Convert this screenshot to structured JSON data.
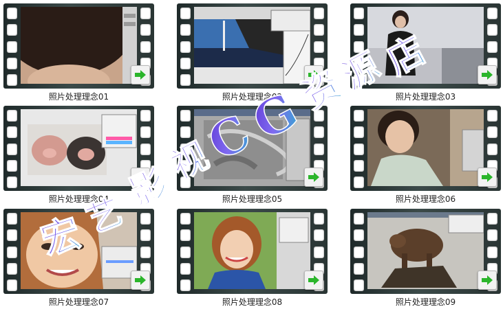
{
  "tiles": [
    {
      "caption": "照片处理理念01"
    },
    {
      "caption": "照片处理理念02"
    },
    {
      "caption": "照片处理理念03"
    },
    {
      "caption": "照片处理理念04"
    },
    {
      "caption": "照片处理理念05"
    },
    {
      "caption": "照片处理理念06"
    },
    {
      "caption": "照片处理理念07"
    },
    {
      "caption": "照片处理理念08"
    },
    {
      "caption": "照片处理理念09"
    }
  ],
  "watermark": {
    "text": "宏艺影视CG资源店"
  },
  "icons": {
    "play": "green-arrow-icon"
  },
  "colors": {
    "arrow": "#2bb52b",
    "film": "#2f3b3a",
    "watermark": "#6a4fd6"
  }
}
